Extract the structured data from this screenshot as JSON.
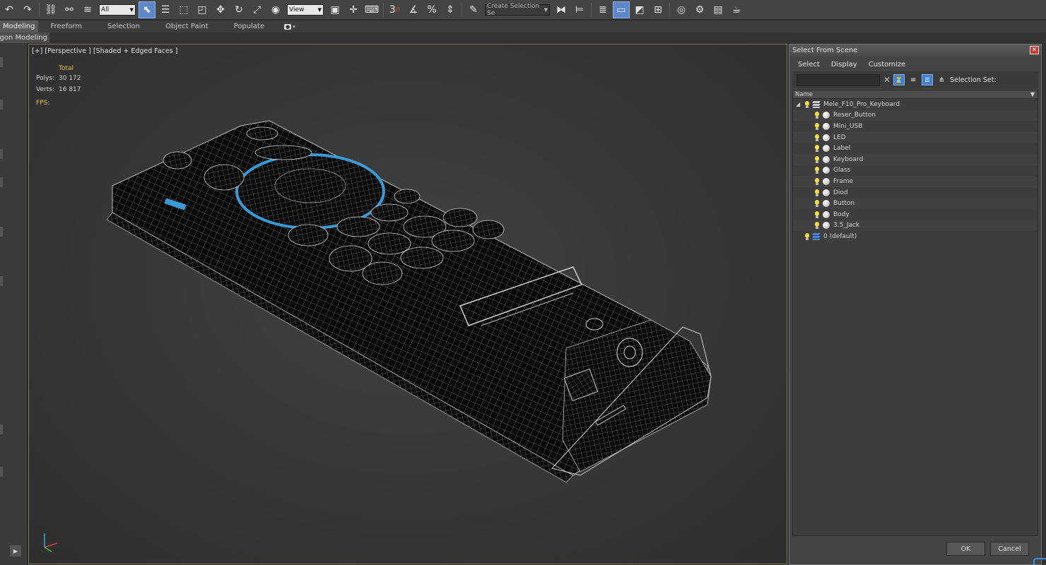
{
  "toolbar": {
    "selection_filter": "All",
    "reference_coord": "View",
    "named_selection_set": "Create Selection Se",
    "snap_count": "3"
  },
  "ribbon": {
    "tabs": [
      {
        "label": "Modeling"
      },
      {
        "label": "Freeform"
      },
      {
        "label": "Selection"
      },
      {
        "label": "Object Paint"
      },
      {
        "label": "Populate"
      }
    ],
    "sub_tab": "Polygon Modeling"
  },
  "viewport": {
    "label": "[+] [Perspective ] [Shaded + Edged Faces ]",
    "stats": {
      "header": "Total",
      "polys_label": "Polys:",
      "polys_value": "30 172",
      "verts_label": "Verts:",
      "verts_value": "16 817",
      "fps_label": "FPS:"
    }
  },
  "dialog": {
    "title": "Select From Scene",
    "menu": [
      "Select",
      "Display",
      "Customize"
    ],
    "selection_set_label": "Selection Set:",
    "column_header": "Name",
    "root_item": "Mele_F10_Pro_Keyboard",
    "children": [
      "Reser_Button",
      "Mini_USB",
      "LED",
      "Label",
      "Keyboard",
      "Glass",
      "Frame",
      "Diod",
      "Button",
      "Body",
      "3.5_Jack"
    ],
    "default_layer": "0 (default)",
    "ok_label": "OK",
    "cancel_label": "Cancel"
  },
  "colors": {
    "stats_text": "#e8c42a",
    "active_blue": "#3f7fd0",
    "dial_ring": "#3a9ad8",
    "close_red": "#c83a2e"
  }
}
